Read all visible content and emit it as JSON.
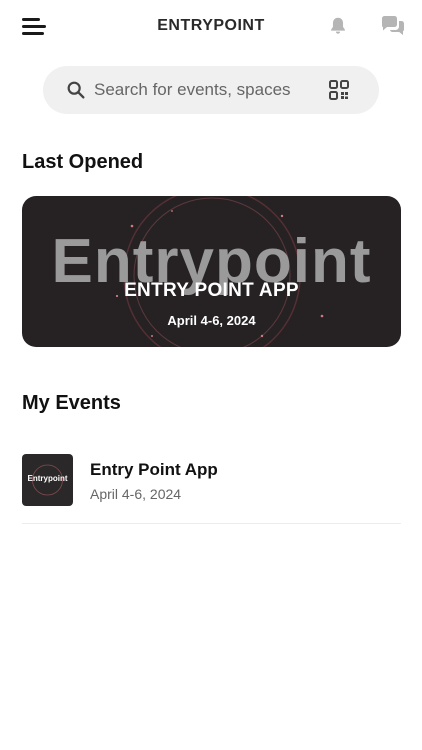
{
  "header": {
    "title": "ENTRYPOINT",
    "menu_icon": "menu-icon",
    "notification_icon": "bell-icon",
    "chat_icon": "chat-bubbles-icon"
  },
  "search": {
    "placeholder": "Search for events, spaces",
    "value": "",
    "icon": "search-icon",
    "scan_icon": "qr-code-icon"
  },
  "last_opened": {
    "heading": "Last Opened",
    "card": {
      "background_word": "Entrypoint",
      "title": "ENTRY POINT APP",
      "date": "April 4-6, 2024"
    }
  },
  "my_events": {
    "heading": "My Events",
    "items": [
      {
        "thumb_text": "Entrypoint",
        "name": "Entry Point App",
        "date": "April 4-6, 2024"
      }
    ]
  },
  "colors": {
    "card_bg": "#262224",
    "search_bg": "#f0f0f0",
    "accent_glow": "#c0656b"
  }
}
